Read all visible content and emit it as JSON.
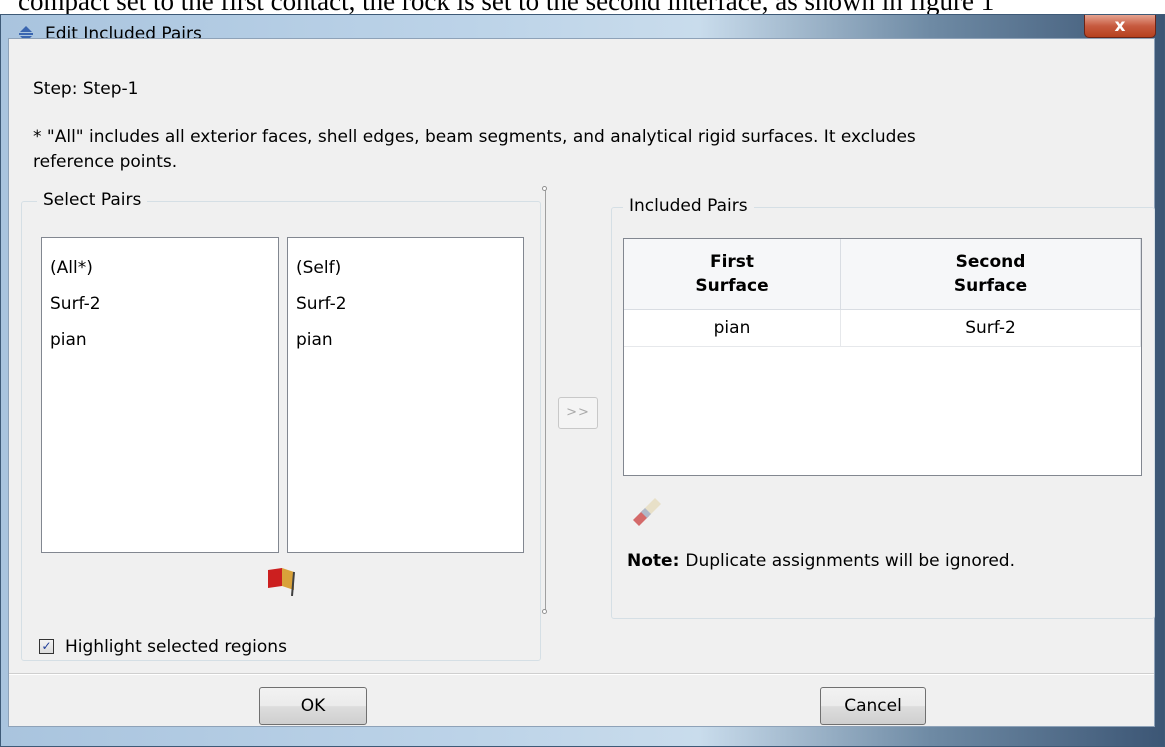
{
  "background_text": "compact set to the first contact, the rock is set to the second interface, as shown in figure 1",
  "window": {
    "title": "Edit Included Pairs",
    "close_label": "x"
  },
  "step": "Step:  Step-1",
  "all_note": "* \"All\" includes all exterior faces, shell edges, beam segments, and analytical rigid surfaces. It excludes reference points.",
  "select_pairs": {
    "label": "Select Pairs",
    "first_list": [
      "(All*)",
      "Surf-2",
      "pian"
    ],
    "second_list": [
      "(Self)",
      "Surf-2",
      "pian"
    ]
  },
  "add_button_label": ">>",
  "included_pairs": {
    "label": "Included Pairs",
    "columns": [
      {
        "line1": "First",
        "line2": "Surface"
      },
      {
        "line1": "Second",
        "line2": "Surface"
      }
    ],
    "rows": [
      {
        "first": "pian",
        "second": "Surf-2"
      }
    ]
  },
  "duplicate_note": {
    "bold": "Note:",
    "text": "Duplicate assignments will be ignored."
  },
  "highlight": {
    "label": "Highlight selected regions",
    "checked": true,
    "mark": "✓"
  },
  "buttons": {
    "ok": "OK",
    "cancel": "Cancel"
  },
  "icons": {
    "title": "abaqus-arrows-icon",
    "eraser": "eraser-icon",
    "flag": "highlight-flag-icon"
  }
}
